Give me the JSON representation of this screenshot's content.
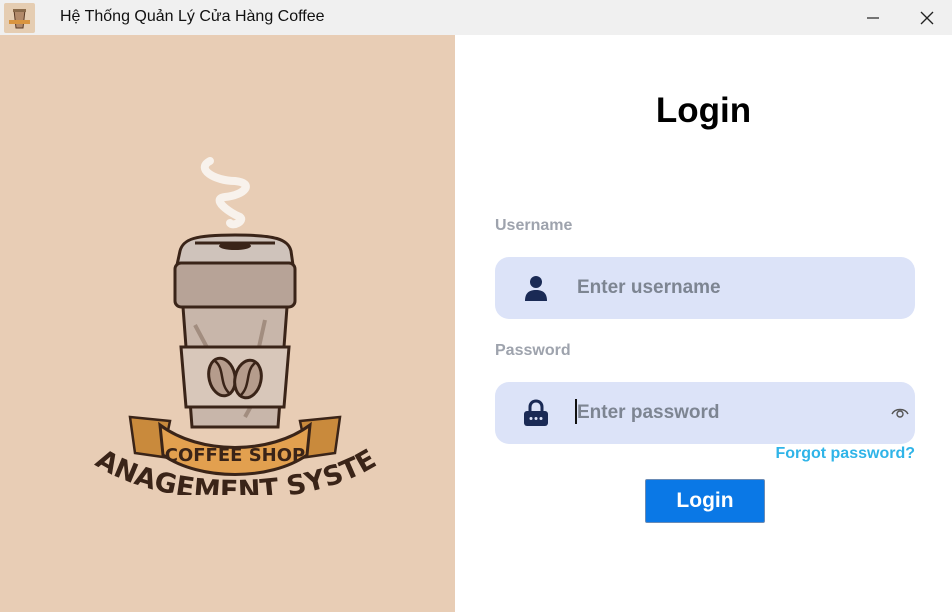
{
  "window": {
    "title": "Hệ Thống Quản Lý Cửa Hàng Coffee",
    "minimize_icon": "minimize-icon",
    "close_icon": "close-icon"
  },
  "logo": {
    "top_text": "COFFEE SHOP",
    "bottom_text": "MANAGEMENT SYSTEM"
  },
  "login": {
    "title": "Login",
    "username_label": "Username",
    "username_placeholder": "Enter username",
    "username_value": "",
    "password_label": "Password",
    "password_placeholder": "Enter password",
    "password_value": "",
    "forgot_password": "Forgot password?",
    "submit_label": "Login"
  },
  "colors": {
    "left_panel": "#e8cdb5",
    "field_bg": "#dce3f8",
    "accent_button": "#0a78e6",
    "link": "#2fb4e8",
    "icon_dark": "#1a2a55"
  }
}
